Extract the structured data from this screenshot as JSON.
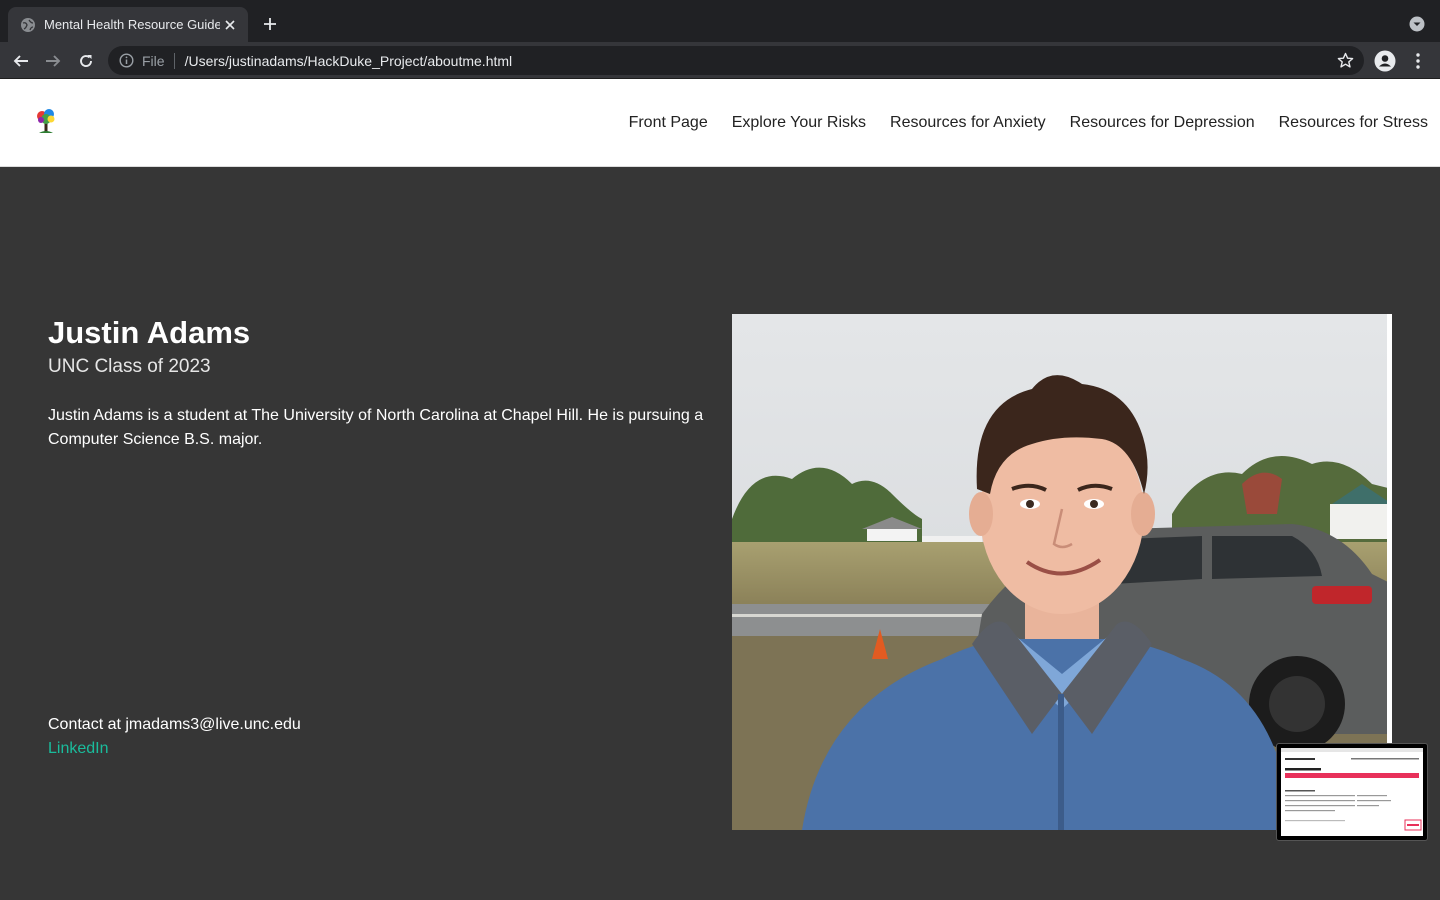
{
  "browser": {
    "tab_title": "Mental Health Resource Guide",
    "address_scheme": "File",
    "address_url": "/Users/justinadams/HackDuke_Project/aboutme.html",
    "icons": [
      "globe-icon",
      "close-icon",
      "plus-icon",
      "chevron-down-icon",
      "back-arrow-icon",
      "forward-arrow-icon",
      "reload-icon",
      "info-icon",
      "star-icon",
      "profile-icon",
      "kebab-menu-icon"
    ]
  },
  "site": {
    "nav": [
      {
        "label": "Front Page"
      },
      {
        "label": "Explore Your Risks"
      },
      {
        "label": "Resources for Anxiety"
      },
      {
        "label": "Resources for Depression"
      },
      {
        "label": "Resources for Stress"
      }
    ]
  },
  "profile": {
    "name": "Justin Adams",
    "class_year": "UNC Class of 2023",
    "bio": "Justin Adams is a student at The University of North Carolina at Chapel Hill. He is pursuing a Computer Science B.S. major.",
    "contact": "Contact at jmadams3@live.unc.edu",
    "linkedin_label": "LinkedIn"
  },
  "colors": {
    "page_bg": "#363636",
    "link_accent": "#1abc9c",
    "header_bg": "#ffffff",
    "chrome_dark": "#202124"
  }
}
